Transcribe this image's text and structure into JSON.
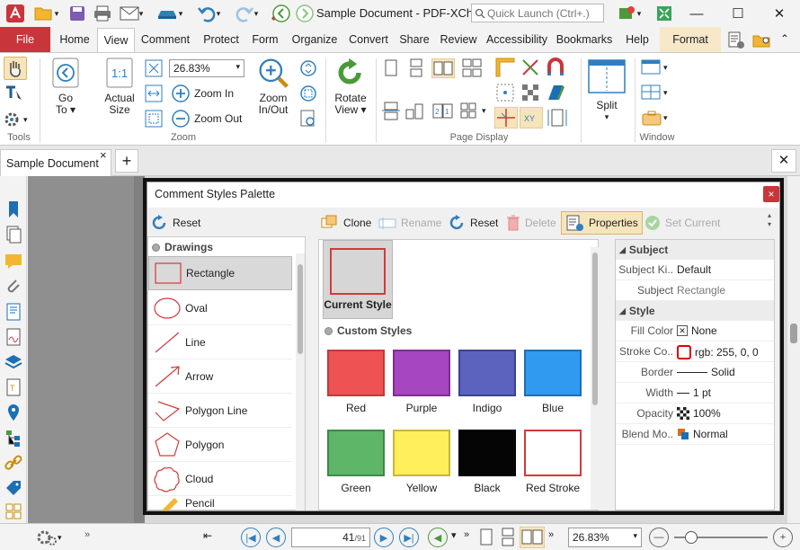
{
  "window": {
    "title": "Sample Document - PDF-XCha...",
    "quick_launch_placeholder": "Quick Launch (Ctrl+.)",
    "minimize": "—",
    "maximize": "☐",
    "close": "✕"
  },
  "ribbon_tabs": [
    "File",
    "Home",
    "View",
    "Comment",
    "Protect",
    "Form",
    "Organize",
    "Convert",
    "Share",
    "Review",
    "Accessibility",
    "Bookmarks",
    "Help",
    "Format"
  ],
  "ribbon": {
    "tools": {
      "label": "Tools"
    },
    "zoom": {
      "label": "Zoom",
      "go_to": "Go",
      "go_to_2": "To",
      "actual_size": "Actual",
      "actual_size_2": "Size",
      "zoom_value": "26.83%",
      "zoom_in": "Zoom In",
      "zoom_out": "Zoom Out",
      "zoom_in_out": "Zoom",
      "zoom_in_out_2": "In/Out"
    },
    "rotate": {
      "label": "Rotate",
      "label_2": "View"
    },
    "page_display": {
      "label": "Page Display"
    },
    "split": {
      "label": "Split"
    },
    "window": {
      "label": "Window"
    }
  },
  "document_tab": {
    "label": "Sample Document",
    "close": "×",
    "add": "+",
    "close_all": "✕"
  },
  "dialog": {
    "title": "Comment Styles Palette",
    "close": "×",
    "left": {
      "reset": "Reset",
      "category": "Drawings",
      "shapes": [
        "Rectangle",
        "Oval",
        "Line",
        "Arrow",
        "Polygon Line",
        "Polygon",
        "Cloud",
        "Pencil"
      ]
    },
    "toolbar": {
      "clone": "Clone",
      "rename": "Rename",
      "reset": "Reset",
      "delete": "Delete",
      "properties": "Properties",
      "set_current": "Set Current"
    },
    "current_style": "Current Style",
    "custom_styles": "Custom Styles",
    "swatches": [
      {
        "name": "Red",
        "fill": "#ee5253",
        "stroke": "#c23a3a"
      },
      {
        "name": "Purple",
        "fill": "#a646c0",
        "stroke": "#7d2f92"
      },
      {
        "name": "Indigo",
        "fill": "#5b63bf",
        "stroke": "#3b4290"
      },
      {
        "name": "Blue",
        "fill": "#2f9aef",
        "stroke": "#1d6fb3"
      },
      {
        "name": "Green",
        "fill": "#5eb669",
        "stroke": "#3d8a46"
      },
      {
        "name": "Yellow",
        "fill": "#ffef5a",
        "stroke": "#c9b63a"
      },
      {
        "name": "Black",
        "fill": "#050505",
        "stroke": "#000000"
      },
      {
        "name": "Red Stroke",
        "fill": "#ffffff",
        "stroke": "#d33a3a"
      }
    ],
    "properties": {
      "subject_section": "Subject",
      "style_section": "Style",
      "rows": [
        {
          "key": "Subject Ki..",
          "value": "Default"
        },
        {
          "key": "Subject",
          "value": "Rectangle"
        },
        {
          "key": "Fill Color",
          "value": "None"
        },
        {
          "key": "Stroke Co..",
          "value": "rgb: 255, 0, 0"
        },
        {
          "key": "Border",
          "value": "Solid"
        },
        {
          "key": "Width",
          "value": "1 pt"
        },
        {
          "key": "Opacity",
          "value": "100%"
        },
        {
          "key": "Blend Mo..",
          "value": "Normal"
        }
      ]
    }
  },
  "status": {
    "page_current": "41",
    "page_total": "/91",
    "zoom": "26.83%"
  }
}
